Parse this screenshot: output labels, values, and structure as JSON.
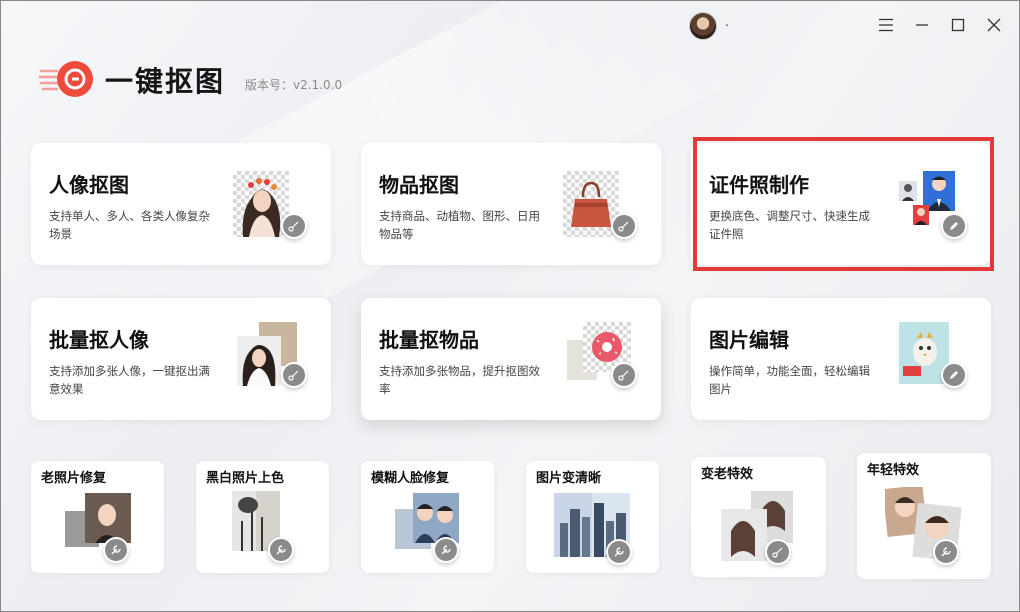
{
  "app": {
    "title": "一键抠图",
    "version": "版本号：v2.1.0.0",
    "username": "."
  },
  "window_controls": [
    "menu-icon",
    "minimize-icon",
    "maximize-icon",
    "close-icon"
  ],
  "cards": [
    {
      "title": "人像抠图",
      "desc": "支持单人、多人、各类人像复杂场景"
    },
    {
      "title": "物品抠图",
      "desc": "支持商品、动植物、图形、日用物品等"
    },
    {
      "title": "证件照制作",
      "desc": "更换底色、调整尺寸、快速生成证件照"
    },
    {
      "title": "批量抠人像",
      "desc": "支持添加多张人像，一键抠出满意效果"
    },
    {
      "title": "批量抠物品",
      "desc": "支持添加多张物品，提升抠图效率"
    },
    {
      "title": "图片编辑",
      "desc": "操作简单，功能全面，轻松编辑图片"
    }
  ],
  "small_cards": [
    {
      "title": "老照片修复"
    },
    {
      "title": "黑白照片上色"
    },
    {
      "title": "模糊人脸修复"
    },
    {
      "title": "图片变清晰"
    },
    {
      "title": "变老特效"
    },
    {
      "title": "年轻特效"
    }
  ],
  "colors": {
    "accent_red": "#e23a3a",
    "logo_red": "#f04a3c",
    "badge_gray": "#8a8a8a"
  }
}
